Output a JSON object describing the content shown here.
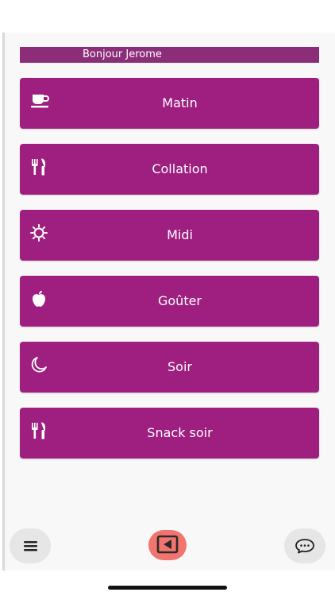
{
  "header": {
    "greeting": "Bonjour Jerome"
  },
  "meals": [
    {
      "label": "Matin",
      "icon": "coffee-cup-icon"
    },
    {
      "label": "Collation",
      "icon": "fork-knife-icon"
    },
    {
      "label": "Midi",
      "icon": "sun-icon"
    },
    {
      "label": "Goûter",
      "icon": "apple-icon"
    },
    {
      "label": "Soir",
      "icon": "moon-icon"
    },
    {
      "label": "Snack soir",
      "icon": "fork-knife-icon"
    }
  ],
  "bottom_bar": {
    "menu_icon": "hamburger-menu-icon",
    "back_icon": "back-arrow-icon",
    "chat_icon": "chat-bubble-icon"
  },
  "colors": {
    "meal_button": "#9e1f80",
    "greeting_bar": "#8b2d78",
    "back_button": "#f2746e"
  }
}
